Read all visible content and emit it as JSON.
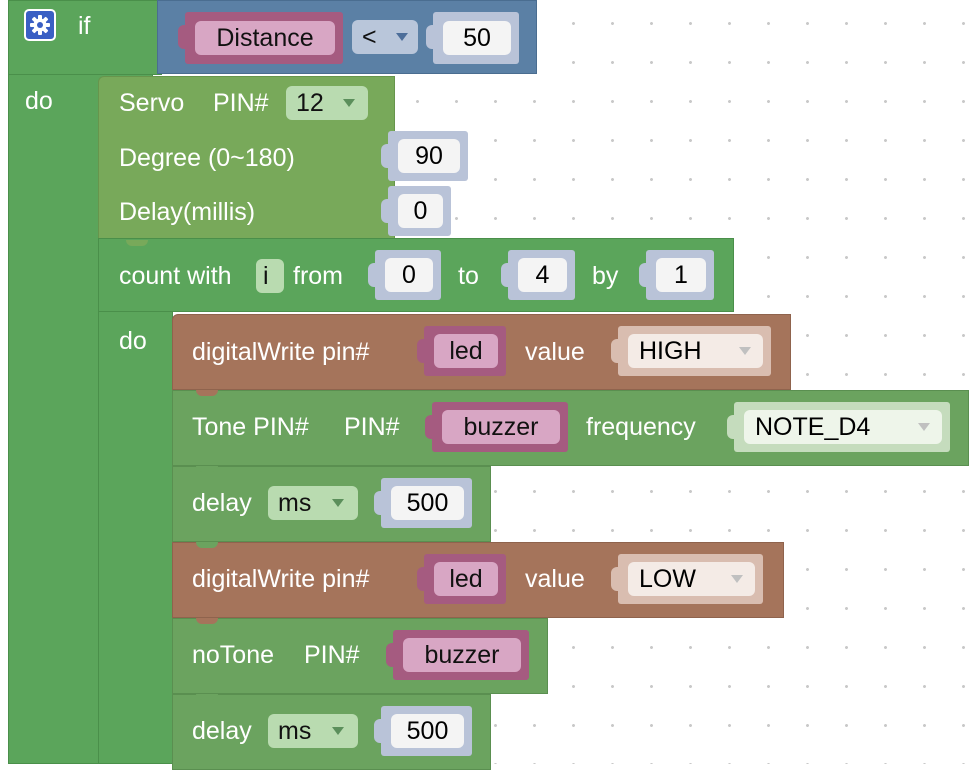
{
  "if_block": {
    "if_label": "if",
    "do_label": "do",
    "condition": {
      "left_var": "Distance",
      "operator": "<",
      "right_value": "50"
    }
  },
  "servo_block": {
    "title": "Servo",
    "pin_label": "PIN#",
    "pin_value": "12",
    "degree_label": "Degree (0~180)",
    "degree_value": "90",
    "delay_label": "Delay(millis)",
    "delay_value": "0"
  },
  "loop_block": {
    "count_label": "count with",
    "var": "i",
    "from_label": "from",
    "from_value": "0",
    "to_label": "to",
    "to_value": "4",
    "by_label": "by",
    "by_value": "1",
    "do_label": "do"
  },
  "statements": {
    "dw1": {
      "label": "digitalWrite pin#",
      "pin": "led",
      "value_label": "value",
      "value": "HIGH"
    },
    "tone": {
      "label": "Tone PIN#",
      "pin_label": "PIN#",
      "pin": "buzzer",
      "freq_label": "frequency",
      "freq": "NOTE_D4"
    },
    "delay1": {
      "label": "delay",
      "unit": "ms",
      "value": "500"
    },
    "dw2": {
      "label": "digitalWrite pin#",
      "pin": "led",
      "value_label": "value",
      "value": "LOW"
    },
    "notone": {
      "label": "noTone",
      "pin_label": "PIN#",
      "pin": "buzzer"
    },
    "delay2": {
      "label": "delay",
      "unit": "ms",
      "value": "500"
    }
  },
  "icons": {
    "settings": "gear-icon",
    "dropdown": "chevron-down-icon"
  },
  "colors": {
    "logic": "#5b80a5",
    "control": "#5ba55b",
    "io_brown": "#a5745b",
    "servo": "#78a95a",
    "variable": "#a55b80",
    "number": "#b9c3d8"
  }
}
